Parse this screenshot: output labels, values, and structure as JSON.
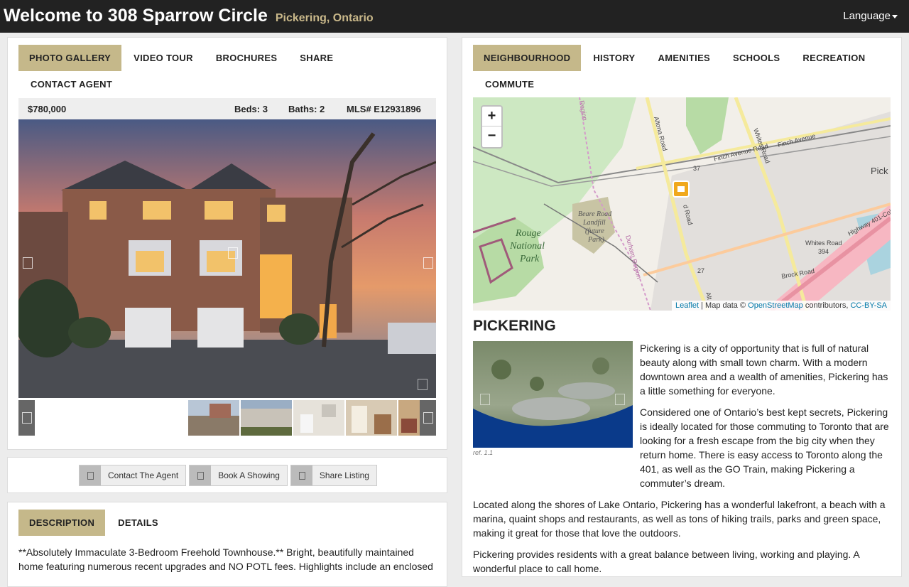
{
  "header": {
    "title": "Welcome to 308 Sparrow Circle",
    "subtitle": "Pickering, Ontario",
    "language_label": "Language"
  },
  "listing": {
    "tabs": [
      "PHOTO GALLERY",
      "VIDEO TOUR",
      "BROCHURES",
      "SHARE",
      "CONTACT AGENT"
    ],
    "price": "$780,000",
    "beds": "Beds: 3",
    "baths": "Baths: 2",
    "mls": "MLS# E12931896"
  },
  "actions": {
    "contact": "Contact The Agent",
    "showing": "Book A Showing",
    "share": "Share Listing"
  },
  "description": {
    "tabs": [
      "DESCRIPTION",
      "DETAILS"
    ],
    "text": "**Absolutely Immaculate 3-Bedroom Freehold Townhouse.** Bright, beautifully maintained home featuring numerous recent upgrades and NO POTL fees. Highlights include an enclosed"
  },
  "neighbourhood": {
    "tabs": [
      "NEIGHBOURHOOD",
      "HISTORY",
      "AMENITIES",
      "SCHOOLS",
      "RECREATION",
      "COMMUTE"
    ],
    "map": {
      "zoom_in": "+",
      "zoom_out": "−",
      "attribution_leaflet": "Leaflet",
      "attribution_mid": " | Map data © ",
      "attribution_osm": "OpenStreetMap",
      "attribution_contrib": " contributors, ",
      "attribution_license": "CC-BY-SA",
      "labels": {
        "park": [
          "Rouge",
          "National",
          "Park"
        ],
        "landfill": [
          "Beare Road",
          "Landfill",
          "(future",
          "Park)"
        ],
        "finch1": "Finch Avenue Road",
        "finch2": "Finch Avenue",
        "whites1": "Whites Road",
        "whites2": "Whites Road",
        "altona": "Altona Road",
        "durham": "Durham Region",
        "brock": "Brock Road",
        "hwy401": "Highway 401-Colle",
        "region": "Region",
        "pick": "Pick",
        "r37": "37",
        "r27": "27",
        "r394": "394",
        "ad": "d Road",
        "alt2": "Alt"
      }
    },
    "heading": "PICKERING",
    "ref": "ref. 1.1",
    "paragraphs": [
      "Pickering is a city of opportunity that is full of natural beauty along with small town charm. With a modern downtown area and a wealth of amenities, Pickering has a little something for everyone.",
      "Considered one of Ontario’s best kept secrets, Pickering is ideally located for those commuting to Toronto that are looking for a fresh escape from the big city when they return home. There is easy access to Toronto along the 401, as well as the GO Train, making Pickering a commuter’s dream.",
      "Located along the shores of Lake Ontario, Pickering has a wonderful lakefront, a beach with a marina, quaint shops and restaurants, as well as tons of hiking trails, parks and green space, making it great for those that love the outdoors.",
      "Pickering provides residents with a great balance between living, working and playing. A wonderful place to call home."
    ]
  },
  "colors": {
    "accent": "#c5b88a",
    "header_bg": "#222222",
    "subtitle": "#c9b88a"
  }
}
